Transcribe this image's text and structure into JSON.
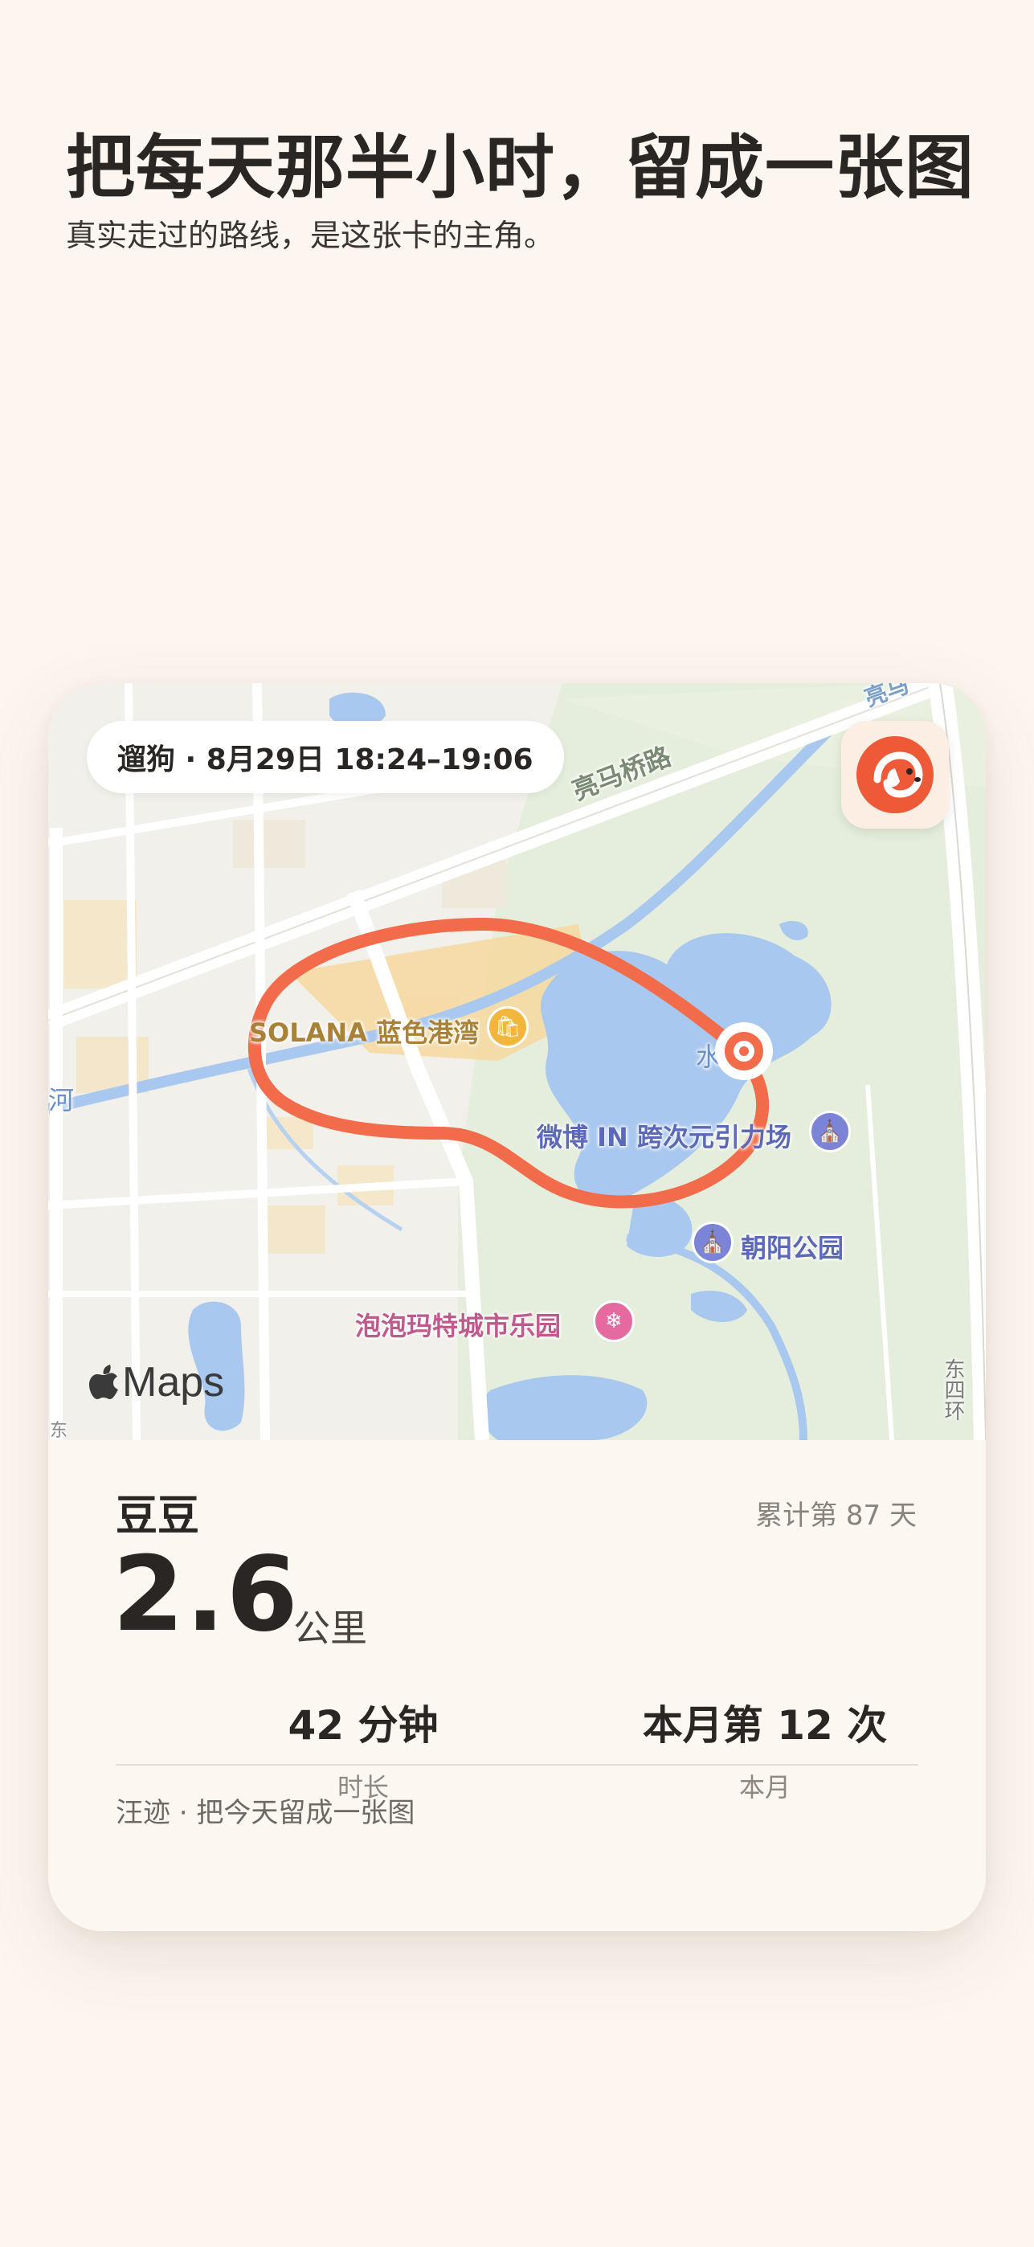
{
  "header": {
    "title": "把每天那半小时，留成一张图",
    "subtitle": "真实走过的路线，是这张卡的主角。"
  },
  "card": {
    "time_pill": "遛狗 · 8月29日 18:24–19:06",
    "app_icon": "dog-logo-icon",
    "map": {
      "labels": {
        "road_liangma": "亮马桥路",
        "road_top_right": "亮马",
        "solana": "SOLANA 蓝色港湾",
        "weibo": "微博 IN 跨次元引力场",
        "chaoyang_park": "朝阳公园",
        "paopao": "泡泡玛特城市乐园",
        "water": "水",
        "river": "河",
        "east_ring": "东四环",
        "edge_left": "东"
      },
      "attribution": "Maps",
      "colors": {
        "route": "#f26b4a",
        "park": "#e4eedb",
        "water": "#a9c8ef",
        "poi_blue": "#7b84d6",
        "poi_gold": "#f2b63c",
        "poi_pink": "#e56aa0"
      }
    },
    "dog_name": "豆豆",
    "streak": "累计第 87 天",
    "distance_value": "2.6",
    "distance_unit": "公里",
    "stats": [
      {
        "value": "42 分钟",
        "label": "时长"
      },
      {
        "value": "本月第 12 次",
        "label": "本月"
      }
    ],
    "footer": "汪迹 · 把今天留成一张图"
  }
}
